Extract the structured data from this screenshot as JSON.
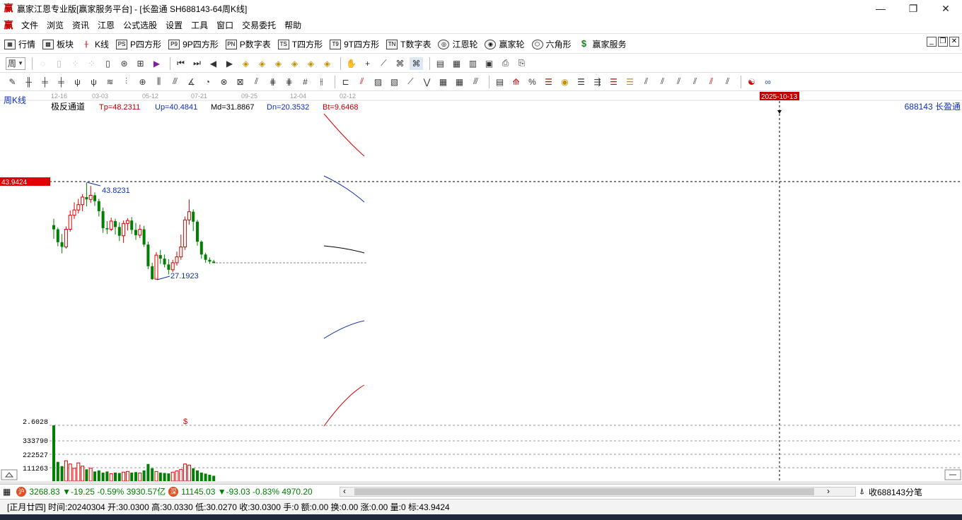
{
  "window": {
    "title": "赢家江恩专业版[赢家服务平台] - [长盈通  SH688143-64周K线]",
    "app_icon": "赢",
    "controls": [
      "minimize-icon",
      "restore-icon",
      "close-icon"
    ]
  },
  "menu": {
    "items": [
      "文件",
      "浏览",
      "资讯",
      "江恩",
      "公式选股",
      "设置",
      "工具",
      "窗口",
      "交易委托",
      "帮助"
    ]
  },
  "toolbar1": {
    "items": [
      {
        "icon": "table-icon",
        "label": "行情"
      },
      {
        "icon": "grid-icon",
        "label": "板块"
      },
      {
        "icon": "candles-icon",
        "label": "K线"
      },
      {
        "icon": "PS",
        "label": "P四方形"
      },
      {
        "icon": "P9",
        "label": "9P四方形"
      },
      {
        "icon": "PN",
        "label": "P数字表"
      },
      {
        "icon": "TS",
        "label": "T四方形"
      },
      {
        "icon": "T9",
        "label": "9T四方形"
      },
      {
        "icon": "TN",
        "label": "T数字表"
      },
      {
        "icon": "wheel-icon",
        "label": "江恩轮"
      },
      {
        "icon": "wheel2-icon",
        "label": "赢家轮"
      },
      {
        "icon": "hexagon-icon",
        "label": "六角形"
      },
      {
        "icon": "dollar-icon",
        "label": "赢家服务"
      }
    ]
  },
  "period_selector": {
    "value": "周"
  },
  "chart": {
    "period_label": "周K线",
    "indicator_name": "极反通道",
    "params": [
      {
        "name": "Tp",
        "value": "Tp=48.2311",
        "color": "#c00000"
      },
      {
        "name": "Up",
        "value": "Up=40.4841",
        "color": "#1030b0"
      },
      {
        "name": "Md",
        "value": "Md=31.8867",
        "color": "#000000"
      },
      {
        "name": "Dn",
        "value": "Dn=20.3532",
        "color": "#1030b0"
      },
      {
        "name": "Bt",
        "value": "Bt=9.6468",
        "color": "#c00000"
      }
    ],
    "date_ticks": [
      "12-16",
      "03-03",
      "05-12",
      "07-21",
      "09-25",
      "12-04",
      "02-12"
    ],
    "cursor_date": "2025-10-13",
    "cursor_price": "43.9424",
    "stock_label": "688143 长盈通",
    "high_label": "43.8231",
    "low_label": "27.1923",
    "volume_axis": [
      "2.6028",
      "333790",
      "222527",
      "111263"
    ],
    "dollar_marker": "$",
    "colors": {
      "up": "#e00000",
      "down": "#008000",
      "accent": "#c00000",
      "blue": "#1030b0"
    }
  },
  "chart_data": {
    "type": "candlestick",
    "symbol": "SH688143",
    "name": "长盈通",
    "period": "周K线",
    "candles": [
      [
        36.5,
        35.8,
        34.2,
        37.6
      ],
      [
        35.8,
        33.6,
        32.9,
        36.1
      ],
      [
        33.6,
        32.8,
        31.7,
        35.0
      ],
      [
        32.8,
        35.8,
        32.5,
        36.3
      ],
      [
        35.8,
        38.2,
        35.4,
        39.0
      ],
      [
        38.2,
        39.1,
        37.6,
        40.4
      ],
      [
        39.1,
        40.0,
        38.5,
        41.0
      ],
      [
        40.0,
        41.3,
        38.9,
        41.8
      ],
      [
        41.3,
        40.9,
        39.7,
        43.8
      ],
      [
        40.9,
        41.6,
        40.3,
        43.2
      ],
      [
        41.6,
        40.6,
        39.8,
        42.1
      ],
      [
        40.6,
        38.9,
        38.0,
        41.0
      ],
      [
        38.9,
        36.0,
        35.2,
        39.5
      ],
      [
        36.0,
        35.8,
        35.0,
        37.2
      ],
      [
        35.8,
        37.2,
        35.5,
        37.8
      ],
      [
        37.2,
        36.2,
        34.9,
        37.6
      ],
      [
        36.2,
        34.7,
        33.8,
        37.0
      ],
      [
        34.7,
        36.8,
        33.5,
        37.3
      ],
      [
        36.8,
        37.3,
        35.6,
        37.7
      ],
      [
        37.3,
        35.7,
        35.0,
        37.9
      ],
      [
        35.7,
        34.8,
        34.0,
        36.9
      ],
      [
        34.8,
        35.8,
        34.3,
        36.6
      ],
      [
        35.8,
        33.2,
        32.8,
        36.4
      ],
      [
        33.2,
        29.5,
        29.0,
        33.7
      ],
      [
        29.5,
        27.3,
        27.2,
        30.1
      ],
      [
        27.3,
        31.4,
        27.2,
        31.9
      ],
      [
        31.4,
        30.8,
        29.9,
        32.3
      ],
      [
        30.8,
        29.8,
        29.3,
        31.5
      ],
      [
        29.8,
        28.9,
        28.1,
        30.7
      ],
      [
        28.9,
        30.1,
        28.5,
        30.6
      ],
      [
        30.1,
        31.1,
        29.6,
        32.0
      ],
      [
        31.1,
        32.8,
        30.6,
        34.9
      ],
      [
        32.8,
        37.4,
        32.3,
        38.0
      ],
      [
        37.4,
        38.8,
        36.6,
        40.9
      ],
      [
        38.8,
        37.1,
        35.5,
        39.2
      ],
      [
        37.1,
        33.7,
        33.0,
        37.4
      ],
      [
        33.7,
        31.5,
        30.8,
        33.9
      ],
      [
        31.5,
        30.6,
        30.1,
        31.8
      ],
      [
        30.6,
        30.3,
        29.9,
        31.0
      ],
      [
        30.3,
        30.03,
        30.027,
        30.6
      ]
    ],
    "volume": [
      260280,
      90000,
      70000,
      95000,
      80000,
      60000,
      85000,
      70000,
      55000,
      60000,
      45000,
      50000,
      40000,
      45000,
      35000,
      40000,
      38000,
      42000,
      45000,
      40000,
      42000,
      38000,
      50000,
      80000,
      60000,
      45000,
      40000,
      38000,
      36000,
      42000,
      48000,
      55000,
      80000,
      75000,
      60000,
      50000,
      40000,
      35000,
      30000,
      25000
    ],
    "annotations": {
      "high": 43.8231,
      "low": 27.1923,
      "cursor_price": 43.9424,
      "cursor_date": "2025-10-13"
    },
    "channel": {
      "Tp": 48.2311,
      "Up": 40.4841,
      "Md": 31.8867,
      "Dn": 20.3532,
      "Bt": 9.6468
    }
  },
  "status1": {
    "sh_value": "3268.83",
    "sh_change": "▼-19.25",
    "sh_pct": "-0.59%",
    "sh_amount": "3930.57亿",
    "sz_value": "11145.03",
    "sz_change": "▼-93.03",
    "sz_pct": "-0.83%",
    "sz_amount": "4970.20",
    "ticks_label": "收688143分笔",
    "sh_icon": "沪",
    "sz_icon": "深"
  },
  "status2": {
    "text": "[正月廿四] 时间:20240304 开:30.0300 高:30.0330 低:30.0270 收:30.0300 手:0 额:0.00 换:0.00 涨:0.00 量:0 标:43.9424"
  }
}
